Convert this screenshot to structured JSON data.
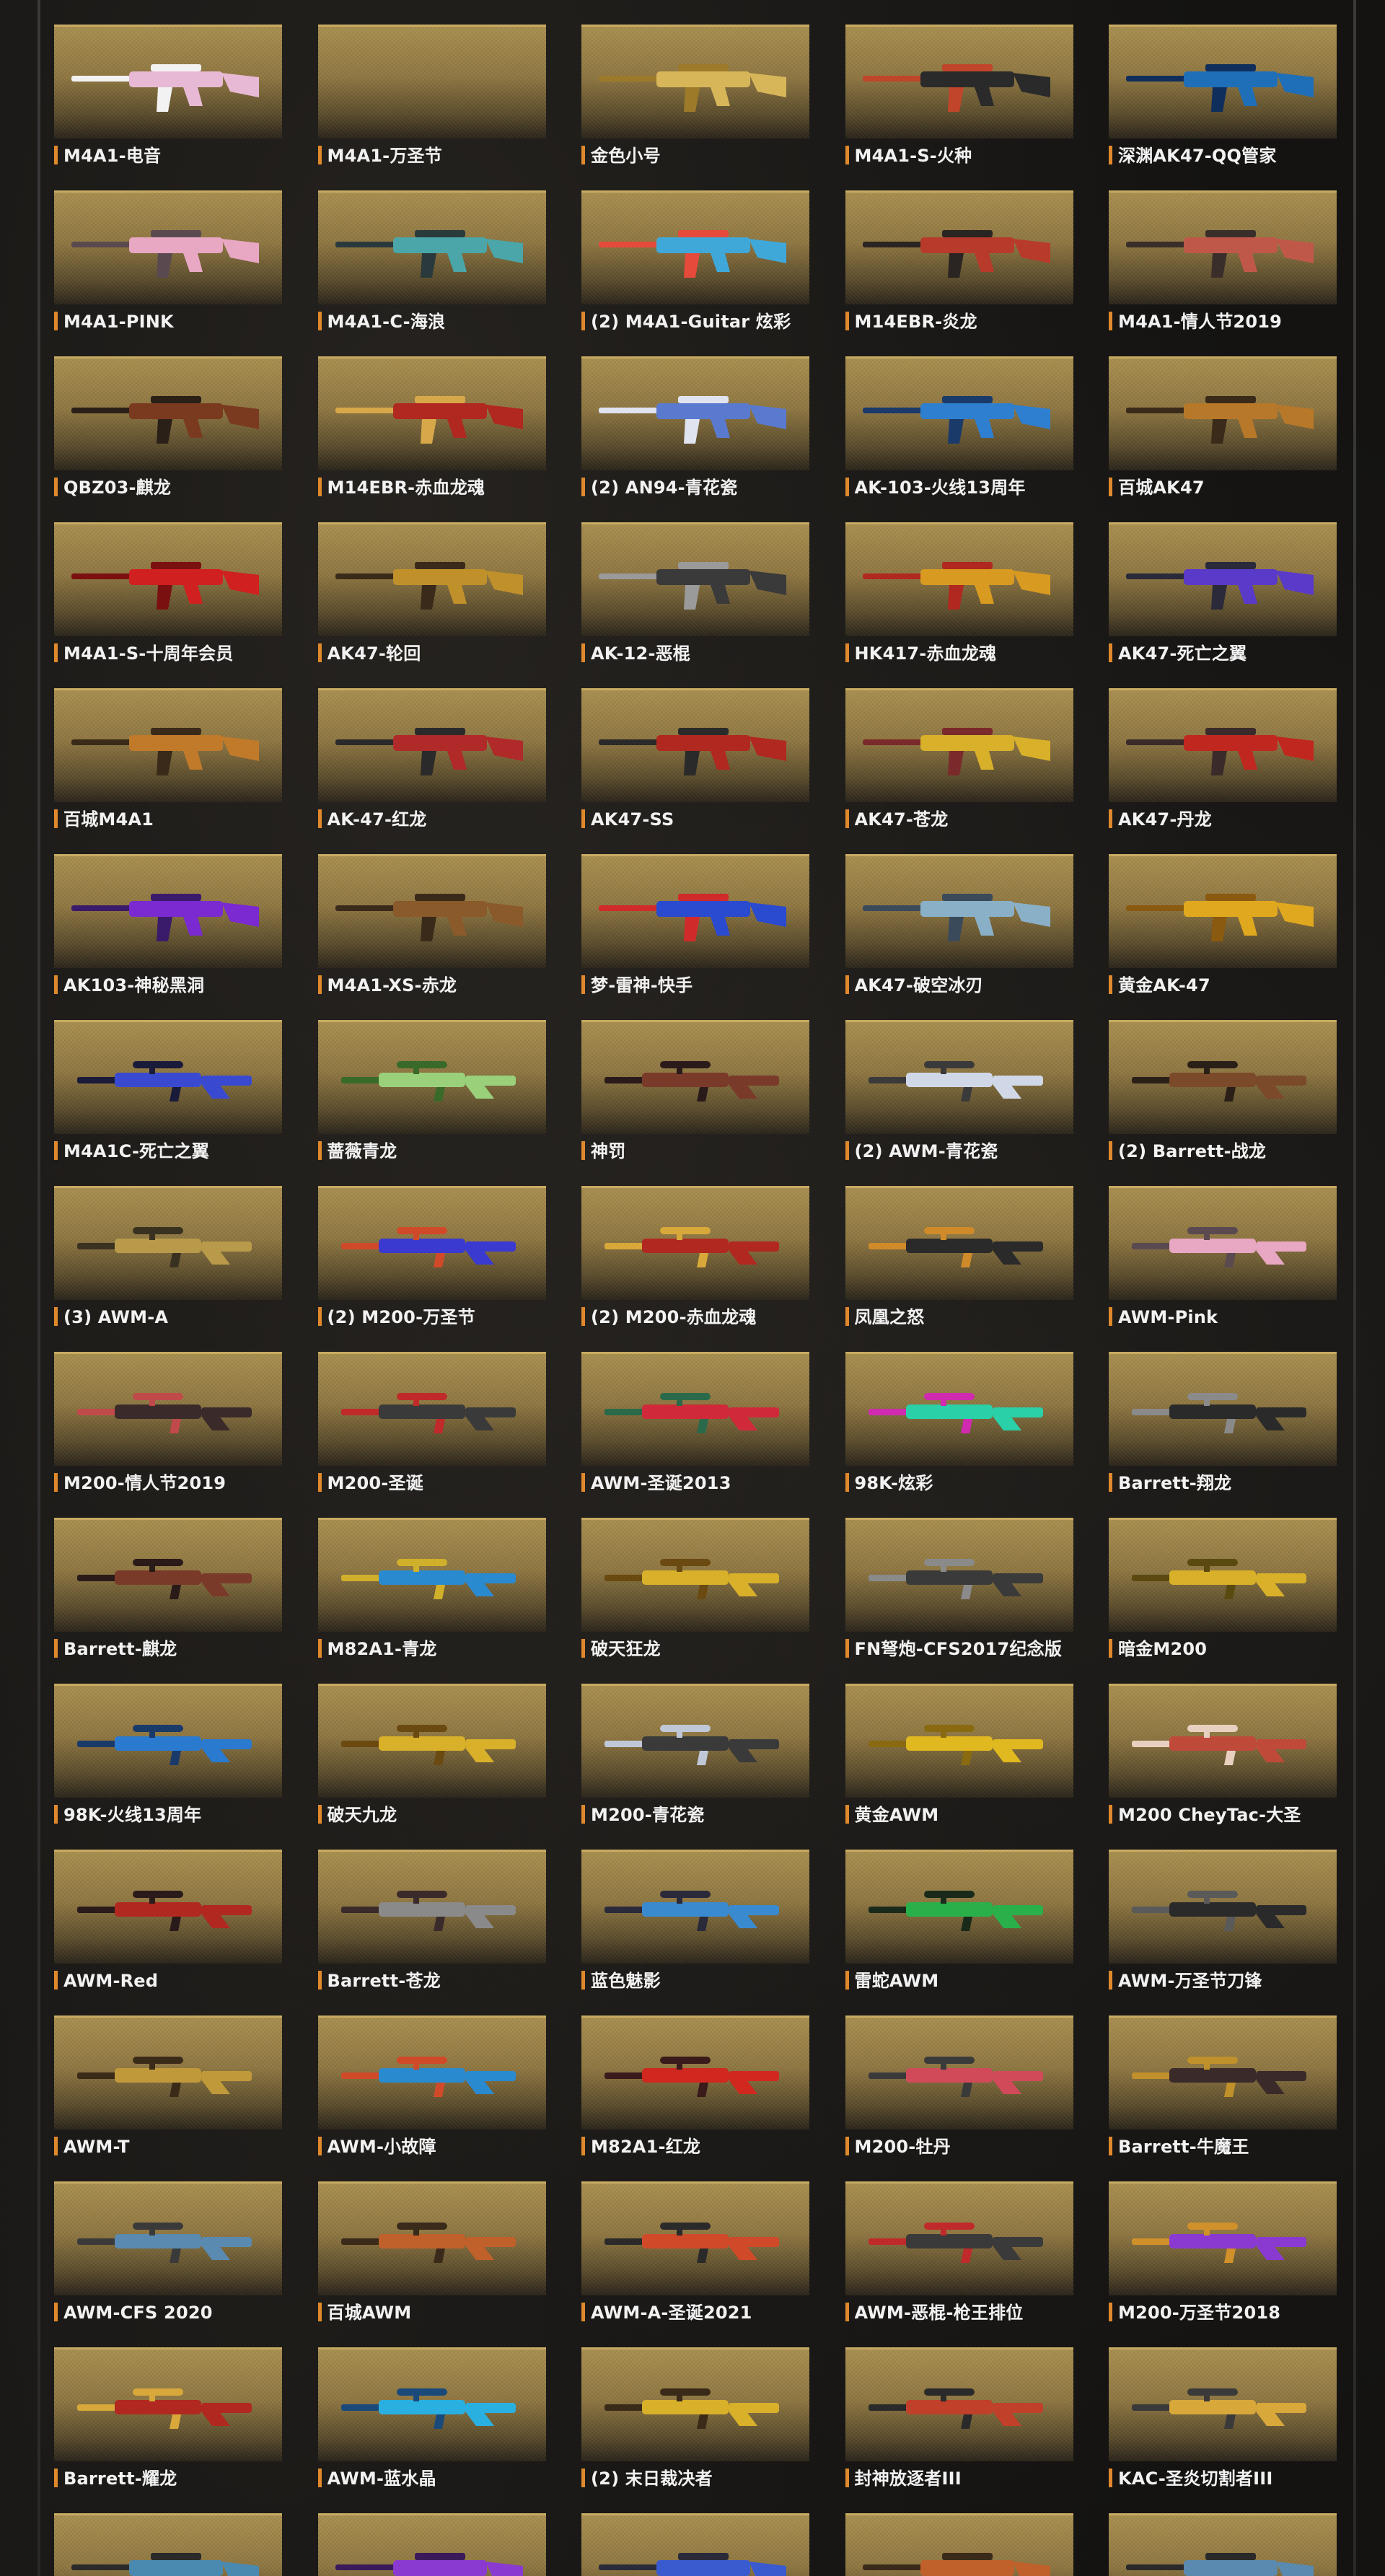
{
  "items": [
    {
      "name": "M4A1-电音",
      "colors": [
        "#e7b9d4",
        "#f2f2f2"
      ]
    },
    {
      "name": "M4A1-万圣节",
      "colors": [
        "#8f7742",
        "#8f7742"
      ]
    },
    {
      "name": "金色小号",
      "colors": [
        "#d7b65a",
        "#9c7a2a"
      ]
    },
    {
      "name": "M4A1-S-火种",
      "colors": [
        "#2a2a2a",
        "#c0452a"
      ]
    },
    {
      "name": "深渊AK47-QQ管家",
      "colors": [
        "#1f6fb8",
        "#0f2e5c"
      ]
    },
    {
      "name": "M4A1-PINK",
      "colors": [
        "#e8a7c3",
        "#5a4a50"
      ]
    },
    {
      "name": "M4A1-C-海浪",
      "colors": [
        "#4aa6a8",
        "#2a3a3c"
      ]
    },
    {
      "name": "(2) M4A1-Guitar 炫彩",
      "colors": [
        "#3fa8d8",
        "#e54a3a"
      ]
    },
    {
      "name": "M14EBR-炎龙",
      "colors": [
        "#b83a2a",
        "#2a2422"
      ]
    },
    {
      "name": "M4A1-情人节2019",
      "colors": [
        "#c0584a",
        "#3a2e2a"
      ]
    },
    {
      "name": "QBZ03-麒龙",
      "colors": [
        "#7a3a1f",
        "#2a2018"
      ]
    },
    {
      "name": "M14EBR-赤血龙魂",
      "colors": [
        "#b0281f",
        "#d7a84a"
      ]
    },
    {
      "name": "(2) AN94-青花瓷",
      "colors": [
        "#5a7ad0",
        "#e0e4f0"
      ]
    },
    {
      "name": "AK-103-火线13周年",
      "colors": [
        "#2f7fd0",
        "#1a3a6a"
      ]
    },
    {
      "name": "百城AK47",
      "colors": [
        "#b8782a",
        "#3a2a1a"
      ]
    },
    {
      "name": "M4A1-S-十周年会员",
      "colors": [
        "#d0201f",
        "#7a1010"
      ]
    },
    {
      "name": "AK47-轮回",
      "colors": [
        "#c0902a",
        "#3a2a1a"
      ]
    },
    {
      "name": "AK-12-恶棍",
      "colors": [
        "#3a3a3a",
        "#9a9a9a"
      ]
    },
    {
      "name": "HK417-赤血龙魂",
      "colors": [
        "#d89a20",
        "#b0281f"
      ]
    },
    {
      "name": "AK47-死亡之翼",
      "colors": [
        "#5a3ac8",
        "#2a2a3a"
      ]
    },
    {
      "name": "百城M4A1",
      "colors": [
        "#c07a2a",
        "#3a2a1a"
      ]
    },
    {
      "name": "AK-47-红龙",
      "colors": [
        "#b02a2a",
        "#2a2a2a"
      ]
    },
    {
      "name": "AK47-SS",
      "colors": [
        "#b0281f",
        "#2a2a2a"
      ]
    },
    {
      "name": "AK47-苍龙",
      "colors": [
        "#d8b02a",
        "#7a2a2a"
      ]
    },
    {
      "name": "AK47-丹龙",
      "colors": [
        "#c0281f",
        "#3a2a2a"
      ]
    },
    {
      "name": "AK103-神秘黑洞",
      "colors": [
        "#7a2ad0",
        "#3a1a6a"
      ]
    },
    {
      "name": "M4A1-XS-赤龙",
      "colors": [
        "#8a5a2a",
        "#3a2a1a"
      ]
    },
    {
      "name": "梦-雷神-快手",
      "colors": [
        "#2a4ad0",
        "#d02a2a"
      ]
    },
    {
      "name": "AK47-破空冰刃",
      "colors": [
        "#8ab0c8",
        "#3a4a5a"
      ]
    },
    {
      "name": "黄金AK-47",
      "colors": [
        "#e0a81f",
        "#8a5a10"
      ]
    },
    {
      "name": "M4A1C-死亡之翼",
      "colors": [
        "#3a4ad0",
        "#1a1a3a"
      ]
    },
    {
      "name": "蔷薇青龙",
      "colors": [
        "#9ad07a",
        "#3a6a2a"
      ]
    },
    {
      "name": "神罚",
      "colors": [
        "#7a3a2a",
        "#2a1a1a"
      ]
    },
    {
      "name": "(2) AWM-青花瓷",
      "colors": [
        "#d0d8e8",
        "#3a3a3a"
      ]
    },
    {
      "name": "(2) Barrett-战龙",
      "colors": [
        "#7a4a2a",
        "#2a2018"
      ]
    },
    {
      "name": "(3) AWM-A",
      "colors": [
        "#b89a4a",
        "#3a3220"
      ]
    },
    {
      "name": "(2) M200-万圣节",
      "colors": [
        "#3a3ad0",
        "#d04a2a"
      ]
    },
    {
      "name": "(2) M200-赤血龙魂",
      "colors": [
        "#b0281f",
        "#d8a83a"
      ]
    },
    {
      "name": "凤凰之怒",
      "colors": [
        "#2a2a2a",
        "#d08a2a"
      ]
    },
    {
      "name": "AWM-Pink",
      "colors": [
        "#e8a7c3",
        "#5a4a50"
      ]
    },
    {
      "name": "M200-情人节2019",
      "colors": [
        "#3a2a2a",
        "#c04a4a"
      ]
    },
    {
      "name": "M200-圣诞",
      "colors": [
        "#3a3a3a",
        "#c02a2a"
      ]
    },
    {
      "name": "AWM-圣诞2013",
      "colors": [
        "#d02a3a",
        "#2a6a4a"
      ]
    },
    {
      "name": "98K-炫彩",
      "colors": [
        "#2ad0a8",
        "#d02ab0"
      ]
    },
    {
      "name": "Barrett-翔龙",
      "colors": [
        "#2a2a2a",
        "#8a8a8a"
      ]
    },
    {
      "name": "Barrett-麒龙",
      "colors": [
        "#7a3a2a",
        "#2a1a18"
      ]
    },
    {
      "name": "M82A1-青龙",
      "colors": [
        "#2a8ad0",
        "#d0b02a"
      ]
    },
    {
      "name": "破天狂龙",
      "colors": [
        "#d8b02a",
        "#6a4a10"
      ]
    },
    {
      "name": "FN弩炮-CFS2017纪念版",
      "colors": [
        "#3a3a3a",
        "#8a8a8a"
      ]
    },
    {
      "name": "暗金M200",
      "colors": [
        "#d8b02a",
        "#5a4a10"
      ]
    },
    {
      "name": "98K-火线13周年",
      "colors": [
        "#2a7ad0",
        "#1a3a6a"
      ]
    },
    {
      "name": "破天九龙",
      "colors": [
        "#d8b02a",
        "#6a4a10"
      ]
    },
    {
      "name": "M200-青花瓷",
      "colors": [
        "#3a3a3a",
        "#c0c8d8"
      ]
    },
    {
      "name": "黄金AWM",
      "colors": [
        "#e0b81f",
        "#8a6a10"
      ]
    },
    {
      "name": "M200 CheyTac-大圣",
      "colors": [
        "#c04a3a",
        "#e8d0c0"
      ]
    },
    {
      "name": "AWM-Red",
      "colors": [
        "#b0281f",
        "#2a1a1a"
      ]
    },
    {
      "name": "Barrett-苍龙",
      "colors": [
        "#8a8a8a",
        "#3a2a2a"
      ]
    },
    {
      "name": "蓝色魅影",
      "colors": [
        "#3a8ad0",
        "#2a2a3a"
      ]
    },
    {
      "name": "雷蛇AWM",
      "colors": [
        "#2ab04a",
        "#1a2a1a"
      ]
    },
    {
      "name": "AWM-万圣节刀锋",
      "colors": [
        "#2a2a2a",
        "#5a5a5a"
      ]
    },
    {
      "name": "AWM-T",
      "colors": [
        "#c09a3a",
        "#3a2a18"
      ]
    },
    {
      "name": "AWM-小故障",
      "colors": [
        "#2a8ad0",
        "#d04a2a"
      ]
    },
    {
      "name": "M82A1-红龙",
      "colors": [
        "#d0281f",
        "#3a1a1a"
      ]
    },
    {
      "name": "M200-牡丹",
      "colors": [
        "#d04a5a",
        "#3a3a3a"
      ]
    },
    {
      "name": "Barrett-牛魔王",
      "colors": [
        "#3a2a2a",
        "#c0902a"
      ]
    },
    {
      "name": "AWM-CFS 2020",
      "colors": [
        "#5a8ab0",
        "#3a3a3a"
      ]
    },
    {
      "name": "百城AWM",
      "colors": [
        "#c0602a",
        "#3a2a1a"
      ]
    },
    {
      "name": "AWM-A-圣诞2021",
      "colors": [
        "#d04a2a",
        "#2a2a2a"
      ]
    },
    {
      "name": "AWM-恶棍-枪王排位",
      "colors": [
        "#3a3a3a",
        "#c02a2a"
      ]
    },
    {
      "name": "M200-万圣节2018",
      "colors": [
        "#8a3ad0",
        "#d0902a"
      ]
    },
    {
      "name": "Barrett-耀龙",
      "colors": [
        "#b0281f",
        "#d8a83a"
      ]
    },
    {
      "name": "AWM-蓝水晶",
      "colors": [
        "#2ab0e0",
        "#1a4a7a"
      ]
    },
    {
      "name": "(2) 末日裁决者",
      "colors": [
        "#d8b02a",
        "#3a2a18"
      ]
    },
    {
      "name": "封神放逐者III",
      "colors": [
        "#c0402a",
        "#2a2a2a"
      ]
    },
    {
      "name": "KAC-圣炎切割者III",
      "colors": [
        "#d8a83a",
        "#3a3a3a"
      ]
    },
    {
      "name": "",
      "colors": [
        "#4a8ab0",
        "#2a2a2a"
      ]
    },
    {
      "name": "",
      "colors": [
        "#8a3ad0",
        "#3a1a5a"
      ]
    },
    {
      "name": "",
      "colors": [
        "#3a5ad0",
        "#2a2a3a"
      ]
    },
    {
      "name": "",
      "colors": [
        "#c0602a",
        "#3a2a1a"
      ]
    },
    {
      "name": "",
      "colors": [
        "#5a8ab0",
        "#2a2a2a"
      ]
    }
  ]
}
